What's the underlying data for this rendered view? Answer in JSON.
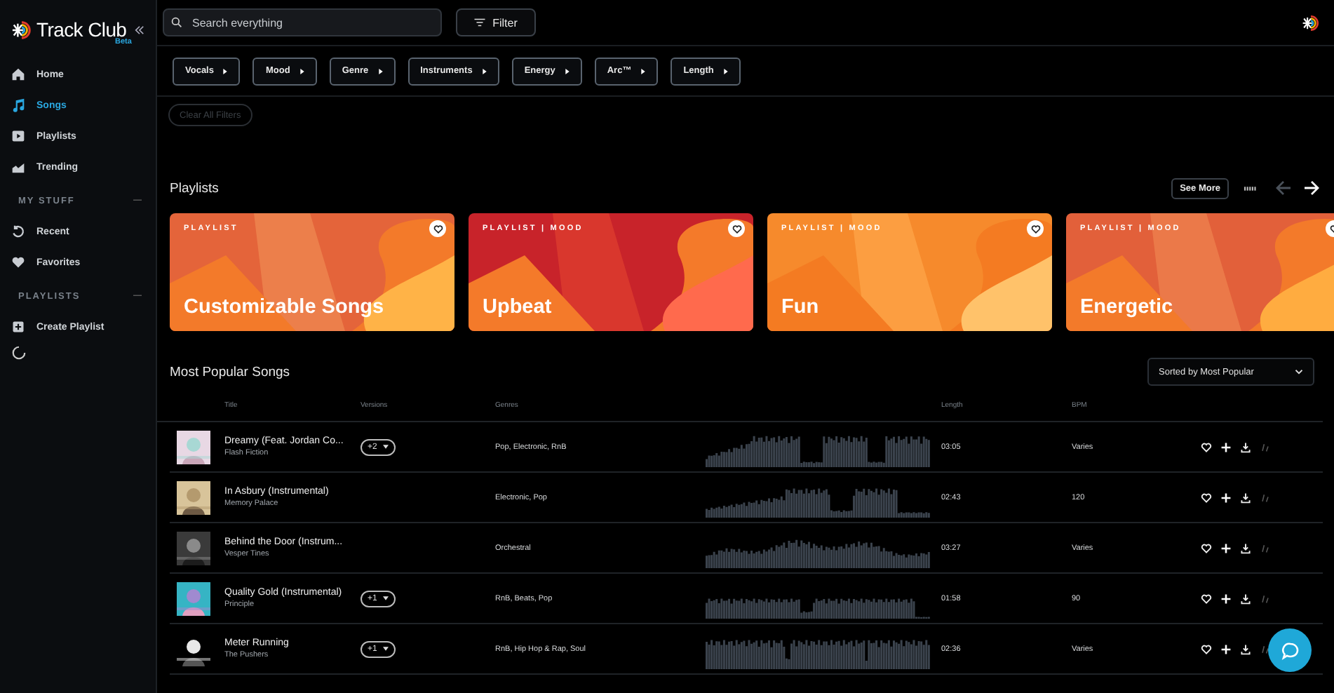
{
  "sidebar": {
    "logo": "Track Club",
    "badge": "Beta",
    "nav": [
      {
        "label": "Home",
        "kind": "home",
        "selected": false
      },
      {
        "label": "Songs",
        "kind": "music",
        "selected": true
      },
      {
        "label": "Playlists",
        "kind": "play",
        "selected": false
      },
      {
        "label": "Trending",
        "kind": "trend",
        "selected": false
      }
    ],
    "sections": [
      {
        "title": "MY STUFF",
        "items": [
          {
            "label": "Recent",
            "kind": "recent"
          },
          {
            "label": "Favorites",
            "kind": "heart"
          }
        ]
      },
      {
        "title": "PLAYLISTS",
        "items": [
          {
            "label": "Create Playlist",
            "kind": "add"
          }
        ]
      }
    ]
  },
  "search": {
    "placeholder": "Search everything"
  },
  "filter_button": "Filter",
  "filters": [
    "Vocals",
    "Mood",
    "Genre",
    "Instruments",
    "Energy",
    "Arc™",
    "Length"
  ],
  "clear_filters": {
    "label": "Clear All Filters",
    "disabled": true
  },
  "playlists": {
    "title": "Playlists",
    "see_more": "See More",
    "prev_disabled": true,
    "next_disabled": false,
    "cards": [
      {
        "label": "PLAYLIST",
        "title": "Customizable Songs"
      },
      {
        "label": "PLAYLIST | MOOD",
        "title": "Upbeat"
      },
      {
        "label": "PLAYLIST | MOOD",
        "title": "Fun"
      },
      {
        "label": "PLAYLIST | MOOD",
        "title": "Energetic"
      }
    ]
  },
  "songs": {
    "title": "Most Popular Songs",
    "sort": "Sorted by Most Popular",
    "columns": [
      "Title",
      "Versions",
      "Genres",
      "Length",
      "BPM"
    ],
    "rows": [
      {
        "title": "Dreamy (Feat. Jordan Co...",
        "artist": "Flash Fiction",
        "versions": "+2",
        "genres": "Pop, Electronic, RnB",
        "length": "03:05",
        "bpm": "Varies"
      },
      {
        "title": "In Asbury (Instrumental)",
        "artist": "Memory Palace",
        "genres": "Electronic, Pop",
        "length": "02:43",
        "bpm": "120"
      },
      {
        "title": "Behind the Door (Instrum...",
        "artist": "Vesper Tines",
        "genres": "Orchestral",
        "length": "03:27",
        "bpm": "Varies"
      },
      {
        "title": "Quality Gold (Instrumental)",
        "artist": "Principle",
        "versions": "+1",
        "genres": "RnB, Beats, Pop",
        "length": "01:58",
        "bpm": "90"
      },
      {
        "title": "Meter Running",
        "artist": "The Pushers",
        "versions": "+1",
        "genres": "RnB, Hip Hop & Rap, Soul",
        "length": "02:36",
        "bpm": "Varies"
      }
    ]
  }
}
